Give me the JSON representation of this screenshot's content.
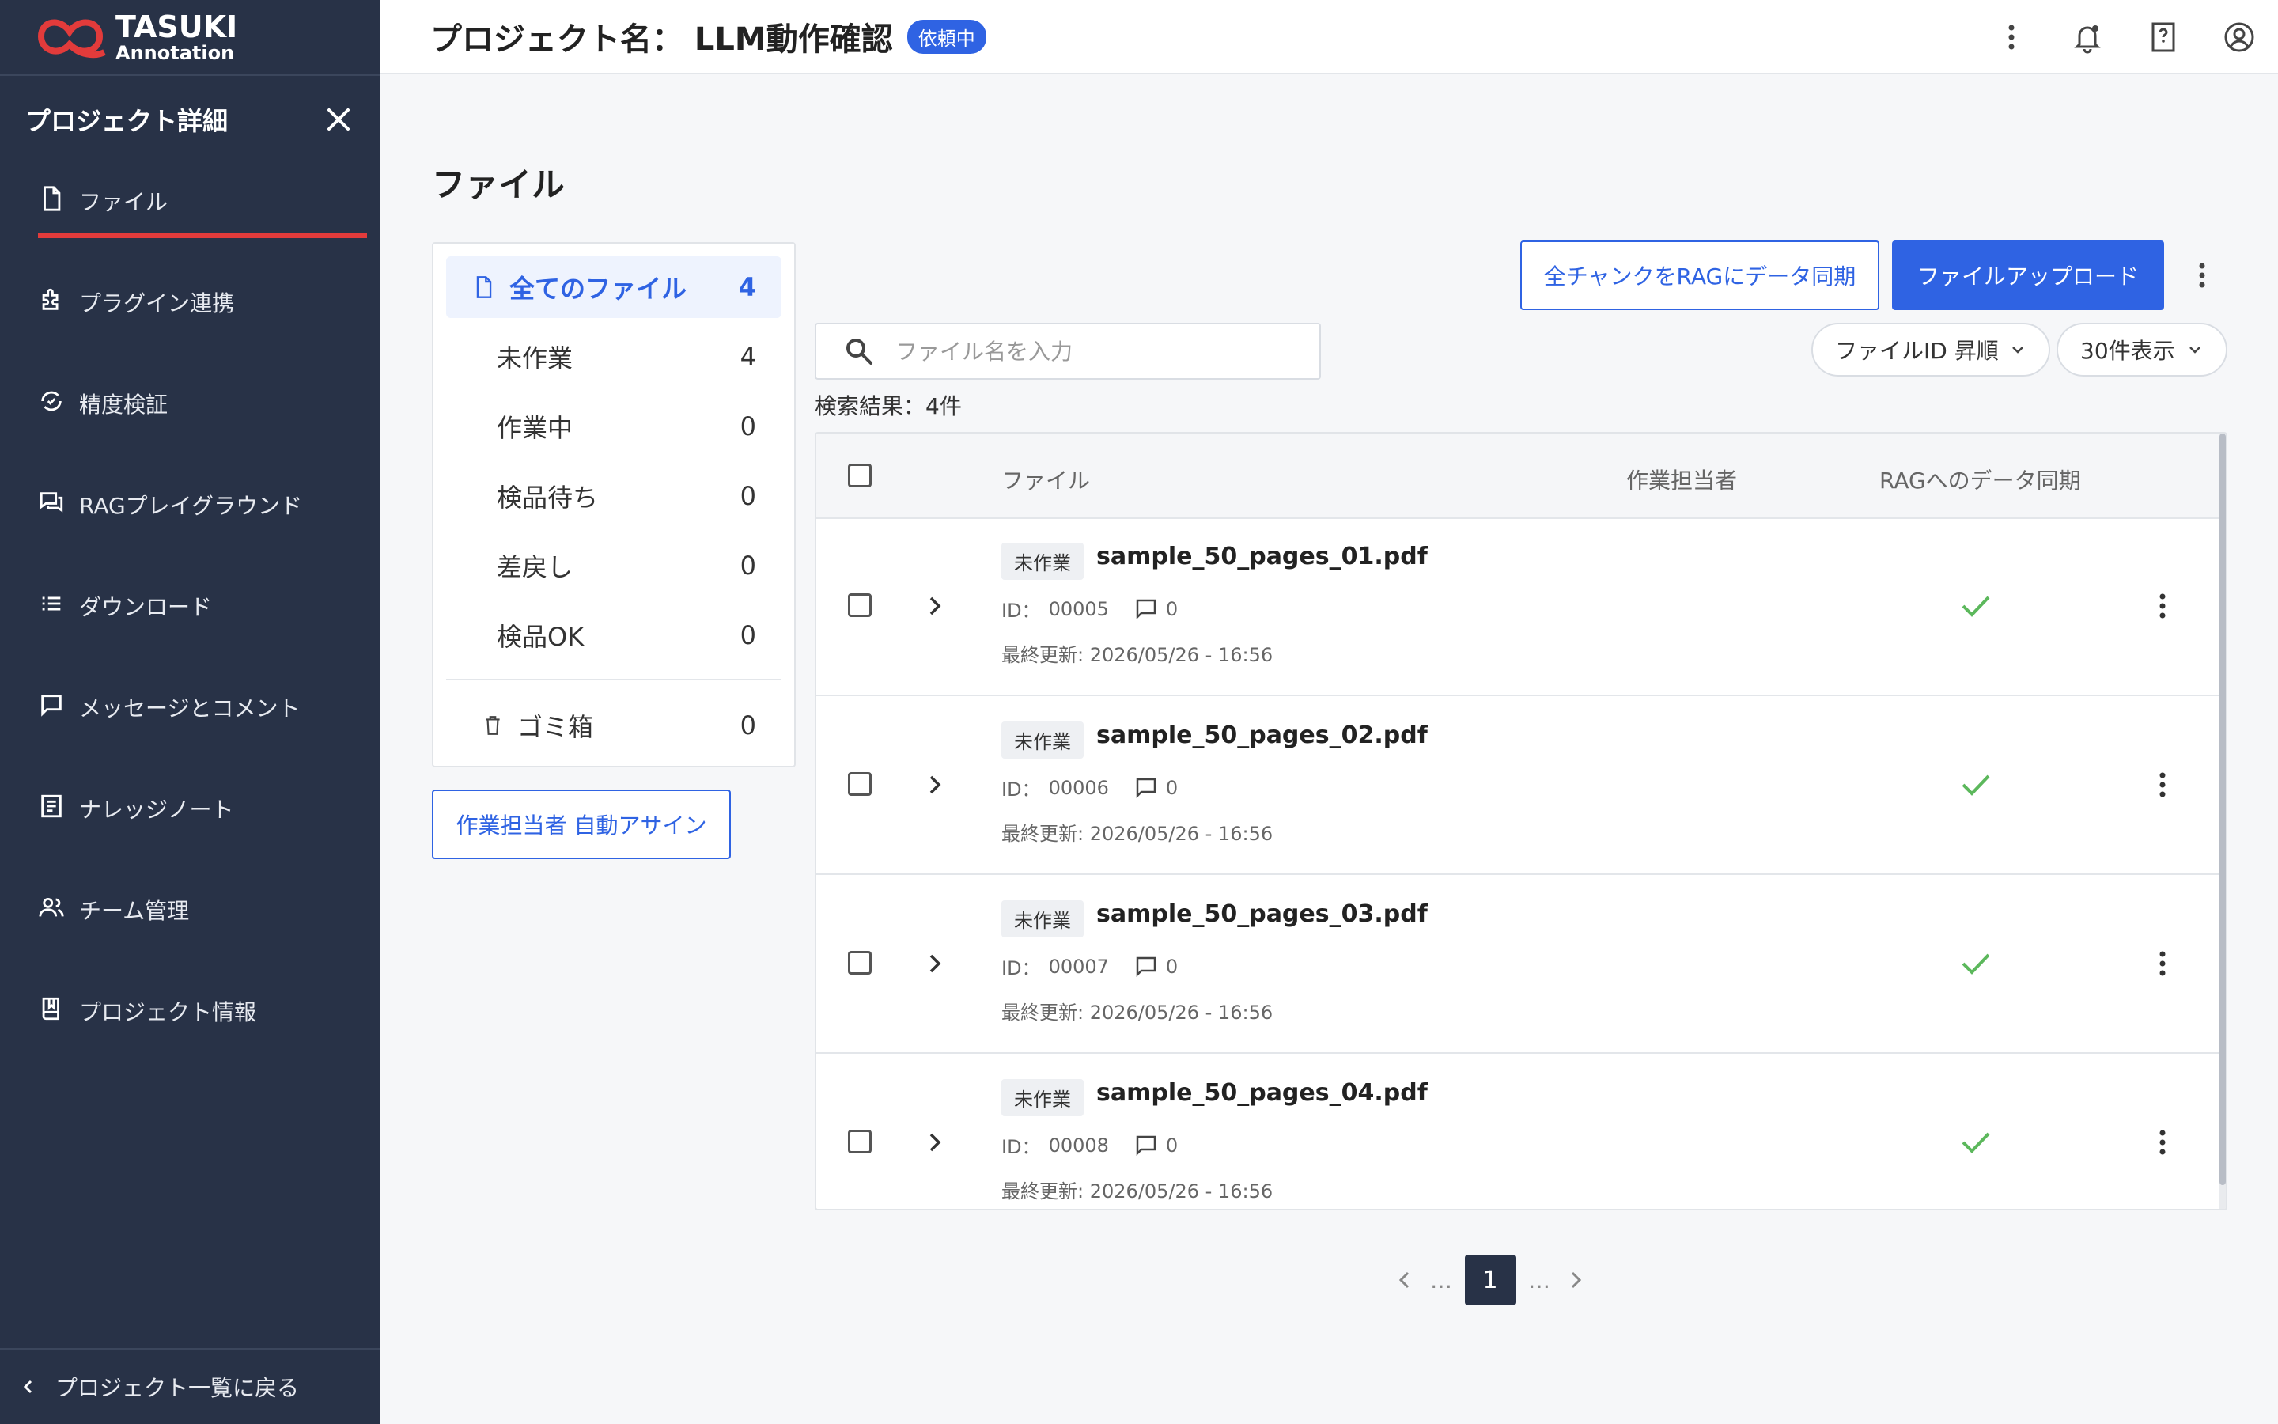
{
  "brand": {
    "title": "TASUKI",
    "subtitle": "Annotation"
  },
  "sidebar": {
    "title": "プロジェクト詳細",
    "items": [
      {
        "label": "ファイル",
        "icon": "file-icon",
        "active": true
      },
      {
        "label": "プラグイン連携",
        "icon": "plugin-icon"
      },
      {
        "label": "精度検証",
        "icon": "verify-icon"
      },
      {
        "label": "RAGプレイグラウンド",
        "icon": "chat-icon"
      },
      {
        "label": "ダウンロード",
        "icon": "list-icon"
      },
      {
        "label": "メッセージとコメント",
        "icon": "message-icon"
      },
      {
        "label": "ナレッジノート",
        "icon": "note-icon"
      },
      {
        "label": "チーム管理",
        "icon": "team-icon"
      },
      {
        "label": "プロジェクト情報",
        "icon": "book-icon"
      }
    ],
    "back_label": "プロジェクト一覧に戻る"
  },
  "header": {
    "project_label": "プロジェクト名： LLM動作確認",
    "status": "依頼中"
  },
  "page": {
    "title": "ファイル"
  },
  "filters": {
    "items": [
      {
        "label": "全てのファイル",
        "count": "4"
      },
      {
        "label": "未作業",
        "count": "4"
      },
      {
        "label": "作業中",
        "count": "0"
      },
      {
        "label": "検品待ち",
        "count": "0"
      },
      {
        "label": "差戻し",
        "count": "0"
      },
      {
        "label": "検品OK",
        "count": "0"
      }
    ],
    "trash": {
      "label": "ゴミ箱",
      "count": "0"
    }
  },
  "actions": {
    "auto_assign": "作業担当者 自動アサイン",
    "sync_all": "全チャンクをRAGにデータ同期",
    "upload": "ファイルアップロード"
  },
  "search": {
    "placeholder": "ファイル名を入力",
    "value": ""
  },
  "sort": {
    "selected": "ファイルID 昇順"
  },
  "per_page": {
    "selected": "30件表示"
  },
  "result_text": "検索結果：4件",
  "table": {
    "columns": {
      "file": "ファイル",
      "assignee": "作業担当者",
      "rag": "RAGへのデータ同期"
    },
    "rows": [
      {
        "status": "未作業",
        "name": "sample_50_pages_01.pdf",
        "id_label": "ID：",
        "id": "00005",
        "comments": "0",
        "updated": "最終更新: 2026/05/26 - 16:56",
        "synced": true
      },
      {
        "status": "未作業",
        "name": "sample_50_pages_02.pdf",
        "id_label": "ID：",
        "id": "00006",
        "comments": "0",
        "updated": "最終更新: 2026/05/26 - 16:56",
        "synced": true
      },
      {
        "status": "未作業",
        "name": "sample_50_pages_03.pdf",
        "id_label": "ID：",
        "id": "00007",
        "comments": "0",
        "updated": "最終更新: 2026/05/26 - 16:56",
        "synced": true
      },
      {
        "status": "未作業",
        "name": "sample_50_pages_04.pdf",
        "id_label": "ID：",
        "id": "00008",
        "comments": "0",
        "updated": "最終更新: 2026/05/26 - 16:56",
        "synced": true
      }
    ]
  },
  "pagination": {
    "current": "1",
    "ellipsis": "…"
  },
  "colors": {
    "accent": "#2f63e3",
    "sidebar": "#283247",
    "active_underline": "#e23b3b",
    "check": "#5cb85c"
  }
}
